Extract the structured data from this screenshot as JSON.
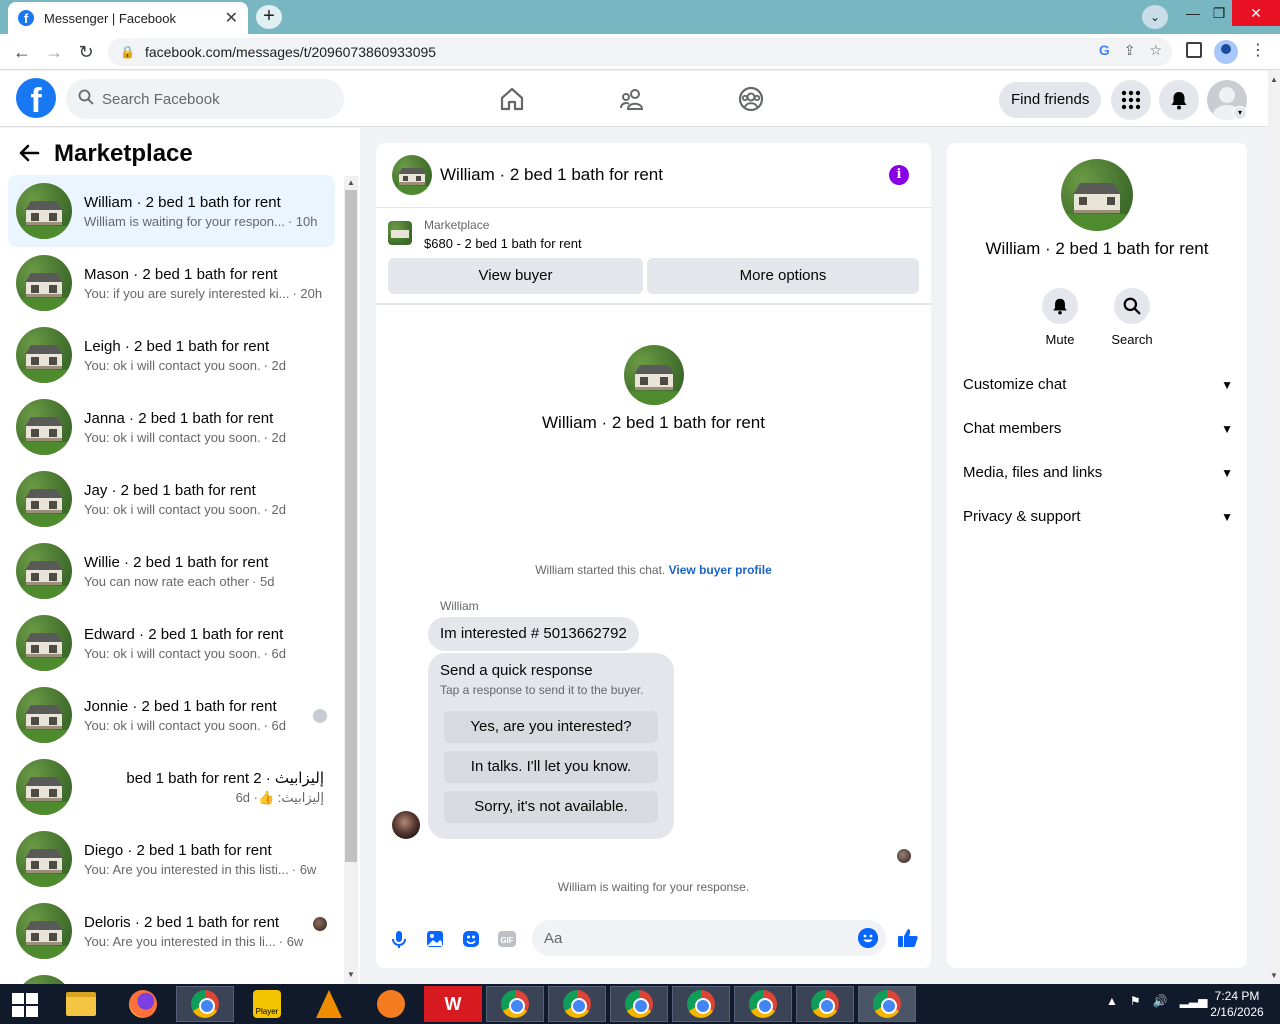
{
  "browser": {
    "tab_title": "Messenger | Facebook",
    "url": "facebook.com/messages/t/2096073860933095"
  },
  "fbnav": {
    "search_placeholder": "Search Facebook",
    "find_friends": "Find friends"
  },
  "left": {
    "title": "Marketplace",
    "conversations": [
      {
        "name": "William · 2 bed 1 bath for rent",
        "preview": "William is waiting for your respon...",
        "time": "· 10h",
        "active": true
      },
      {
        "name": "Mason · 2 bed 1 bath for rent",
        "preview": "You: if you are surely interested ki...",
        "time": "· 20h"
      },
      {
        "name": "Leigh · 2 bed 1 bath for rent",
        "preview": "You: ok i will contact you soon.",
        "time": "· 2d"
      },
      {
        "name": "Janna · 2 bed 1 bath for rent",
        "preview": "You: ok i will contact you soon.",
        "time": "· 2d"
      },
      {
        "name": "Jay · 2 bed 1 bath for rent",
        "preview": "You: ok i will contact you soon.",
        "time": "· 2d"
      },
      {
        "name": "Willie · 2 bed 1 bath for rent",
        "preview": "You can now rate each other",
        "time": "· 5d"
      },
      {
        "name": "Edward · 2 bed 1 bath for rent",
        "preview": "You: ok i will contact you soon.",
        "time": "· 6d"
      },
      {
        "name": "Jonnie · 2 bed 1 bath for rent",
        "preview": "You: ok i will contact you soon.",
        "time": "· 6d"
      },
      {
        "name": "إليزابيث · 2 bed 1 bath for rent",
        "preview": "إليزابيث: 👍",
        "time": "· 6d"
      },
      {
        "name": "Diego · 2 bed 1 bath for rent",
        "preview": "You: Are you interested in this listi...",
        "time": "· 6w"
      },
      {
        "name": "Deloris · 2 bed 1 bath for rent",
        "preview": "You: Are you interested in this li...",
        "time": "· 6w"
      }
    ]
  },
  "chat": {
    "title": "William · 2 bed 1 bath for rent",
    "listing_source": "Marketplace",
    "listing_price": "$680 - 2 bed 1 bath for rent",
    "view_buyer": "View buyer",
    "more_options": "More options",
    "intro_name": "William · 2 bed 1 bath for rent",
    "started_text": "William started this chat.",
    "view_buyer_profile": "View buyer profile",
    "sender": "William",
    "message": "Im interested # 5013662792",
    "quick_title": "Send a quick response",
    "quick_sub": "Tap a response to send it to the buyer.",
    "quick_replies": [
      "Yes, are you interested?",
      "In talks. I'll let you know.",
      "Sorry, it's not available."
    ],
    "waiting": "William is waiting for your response.",
    "composer_placeholder": "Aa"
  },
  "right": {
    "name": "William · 2 bed 1 bath for rent",
    "mute": "Mute",
    "search": "Search",
    "menu": [
      "Customize chat",
      "Chat members",
      "Media, files and links",
      "Privacy & support"
    ]
  },
  "taskbar": {
    "time": "7:24 PM",
    "date": "2/16/2026",
    "player_label": "Player"
  },
  "colors": {
    "fb_blue": "#1877f2",
    "messenger_blue": "#0866ff",
    "info_purple": "#8a00e6",
    "active_row": "#ebf5ff"
  }
}
